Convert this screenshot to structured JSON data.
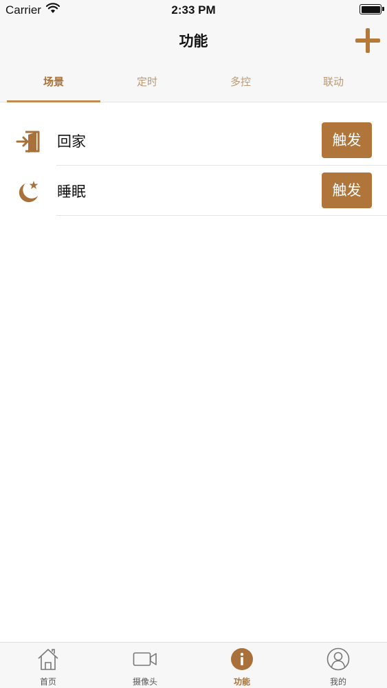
{
  "status_bar": {
    "carrier": "Carrier",
    "time": "2:33 PM"
  },
  "nav": {
    "title": "功能"
  },
  "tabs": [
    {
      "label": "场景",
      "active": true
    },
    {
      "label": "定时",
      "active": false
    },
    {
      "label": "多控",
      "active": false
    },
    {
      "label": "联动",
      "active": false
    }
  ],
  "scenes": [
    {
      "name": "回家",
      "icon": "door-enter-icon",
      "action": "触发"
    },
    {
      "name": "睡眠",
      "icon": "moon-star-icon",
      "action": "触发"
    }
  ],
  "tab_bar": [
    {
      "label": "首页",
      "icon": "home-icon",
      "active": false
    },
    {
      "label": "摄像头",
      "icon": "camera-icon",
      "active": false
    },
    {
      "label": "功能",
      "icon": "info-icon",
      "active": true
    },
    {
      "label": "我的",
      "icon": "user-icon",
      "active": false
    }
  ],
  "colors": {
    "accent": "#b0753a",
    "tab_active": "#a87137",
    "tab_inactive": "#b99a74"
  }
}
